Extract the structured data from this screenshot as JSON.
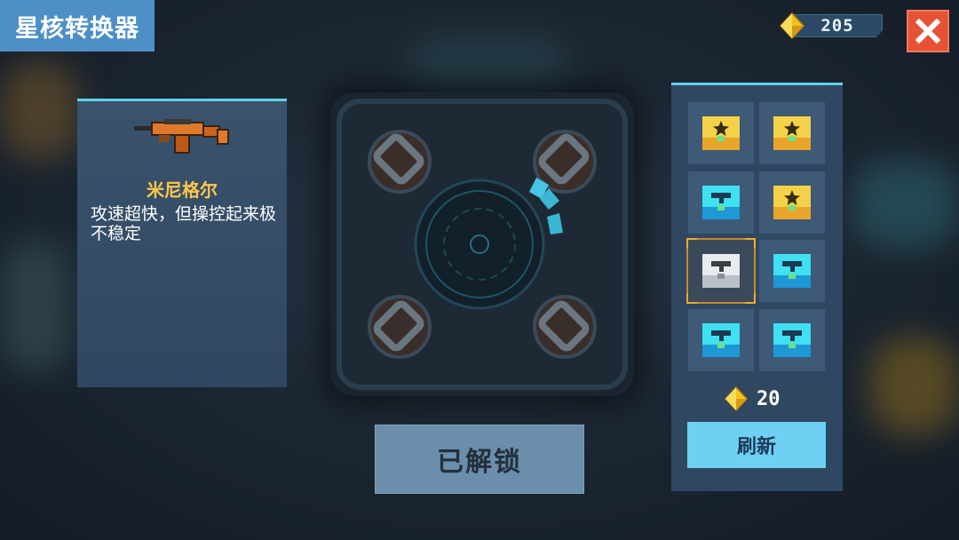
{
  "header": {
    "title": "星核转换器"
  },
  "currency": {
    "icon": "gem-icon",
    "amount": "205"
  },
  "close": {
    "icon": "close-icon"
  },
  "weapon": {
    "name": "米尼格尔",
    "description": "攻速超快，但操控起来极不稳定",
    "icon": "orange-pistol-icon"
  },
  "machine": {
    "charge_segments_lit": 3
  },
  "unlock_button": {
    "label": "已解锁"
  },
  "slots": [
    {
      "icon": "star-chest-icon",
      "color": "yellow",
      "selected": false
    },
    {
      "icon": "star-chest-icon",
      "color": "yellow",
      "selected": false
    },
    {
      "icon": "gun-chest-icon",
      "color": "cyan",
      "selected": false
    },
    {
      "icon": "star-chest-icon",
      "color": "yellow",
      "selected": false
    },
    {
      "icon": "gun-chest-icon",
      "color": "white",
      "selected": true
    },
    {
      "icon": "gun-chest-icon",
      "color": "cyan",
      "selected": false
    },
    {
      "icon": "gun-chest-icon",
      "color": "cyan",
      "selected": false
    },
    {
      "icon": "gun-chest-icon",
      "color": "cyan",
      "selected": false
    }
  ],
  "refresh": {
    "cost": "20",
    "label": "刷新",
    "cost_icon": "gem-icon"
  },
  "colors": {
    "accent": "#5fd3e8",
    "gold": "#ffc84a",
    "close": "#e65236",
    "refresh": "#6fd0f3"
  }
}
